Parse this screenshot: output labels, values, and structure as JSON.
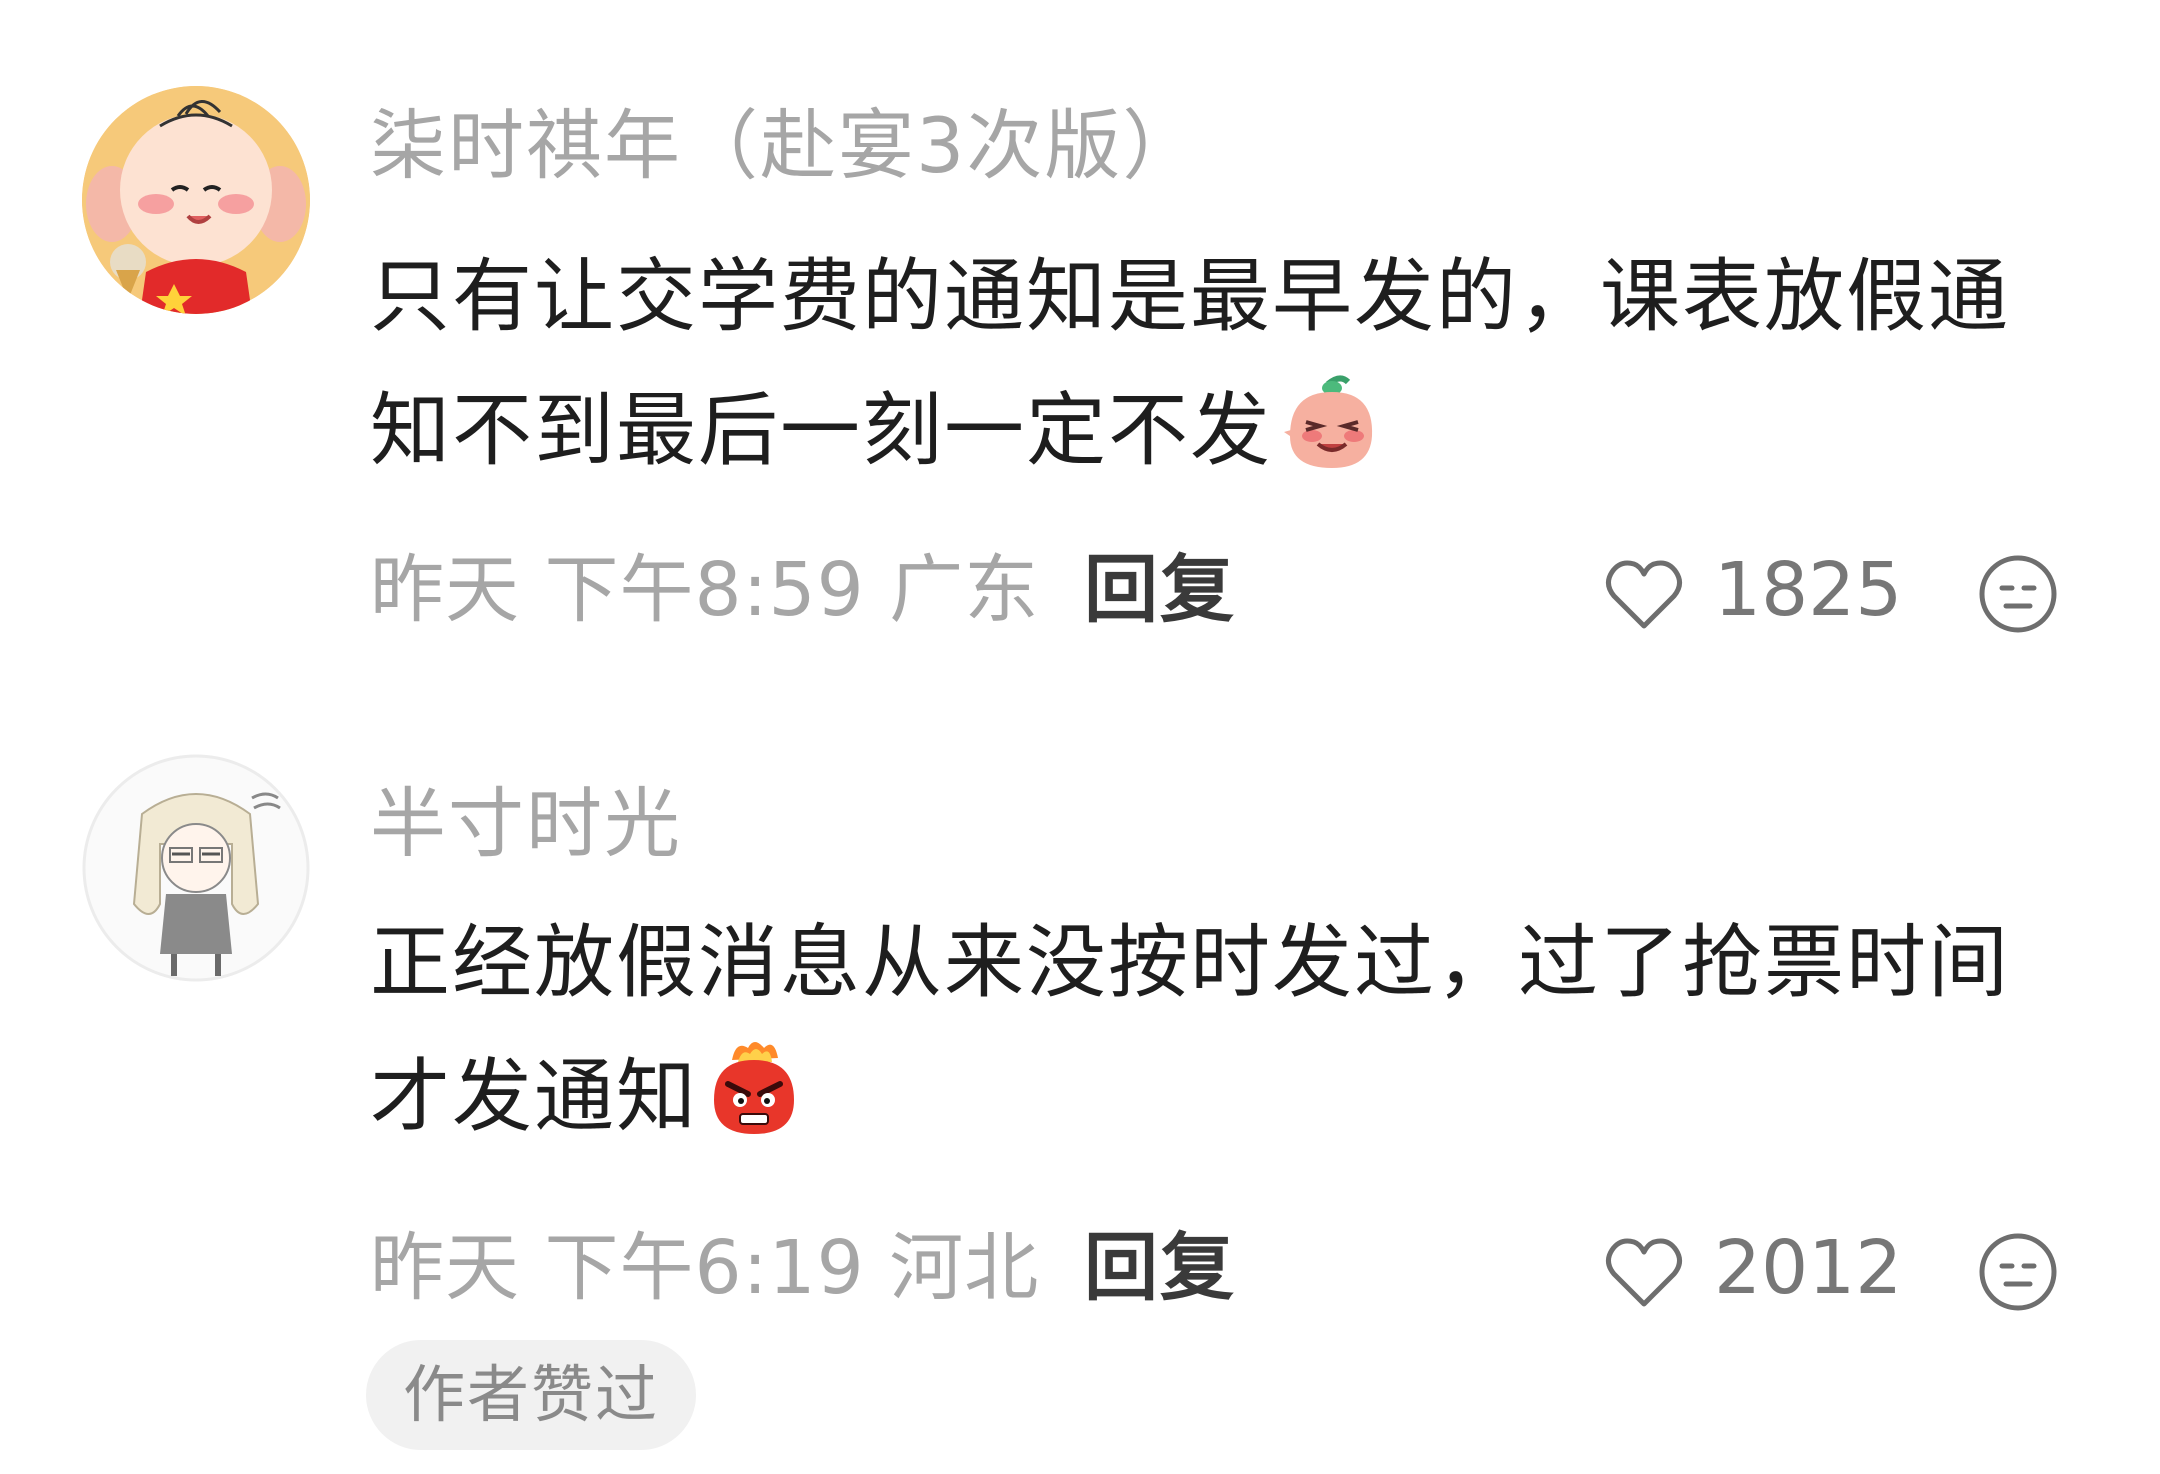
{
  "comments": [
    {
      "username": "柒时祺年（赴宴3次版）",
      "text": "只有让交学费的通知是最早发的，课表放假通知不到最后一刻一定不发",
      "emoji": "blushing-face-emoji",
      "time": "昨天 下午8:59 广东",
      "reply_label": "回复",
      "likes": "1825"
    },
    {
      "username": "半寸时光",
      "text": "正经放假消息从来没按时发过，过了抢票时间才发通知",
      "emoji": "angry-face-emoji",
      "time": "昨天 下午6:19 河北",
      "reply_label": "回复",
      "likes": "2012",
      "badge": "作者赞过"
    }
  ],
  "icons": {
    "like": "heart-outline-icon",
    "dislike": "meh-face-icon"
  },
  "colors": {
    "username": "#a6a6a6",
    "body_text": "#1e1e1e",
    "meta": "#a6a6a6",
    "reply": "#3a3a3a",
    "like_count": "#777777",
    "badge_bg": "#f1f1f1"
  }
}
